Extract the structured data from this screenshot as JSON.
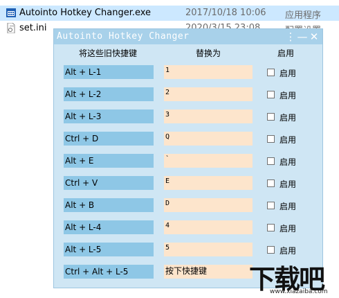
{
  "explorer": {
    "files": [
      {
        "name": "Autointo Hotkey Changer.exe",
        "date": "2017/10/18 10:06",
        "type": "应用程序",
        "icon": "exe-icon"
      },
      {
        "name": "set.ini",
        "date": "2020/3/15 23:08",
        "type": "配置设置",
        "icon": "ini-file-icon"
      }
    ]
  },
  "window": {
    "title": "Autointo Hotkey Changer",
    "menu_glyph": "⋮",
    "min_glyph": "—",
    "close_glyph": "✕"
  },
  "headers": {
    "old_hotkey": "将这些旧快捷键",
    "replace_with": "替换为",
    "enable": "启用"
  },
  "rows": [
    {
      "hotkey": "Alt + L-1",
      "replace": "1",
      "enable_label": "启用"
    },
    {
      "hotkey": "Alt + L-2",
      "replace": "2",
      "enable_label": "启用"
    },
    {
      "hotkey": "Alt + L-3",
      "replace": "3",
      "enable_label": "启用"
    },
    {
      "hotkey": "Ctrl + D",
      "replace": "Q",
      "enable_label": "启用"
    },
    {
      "hotkey": "Alt + E",
      "replace": "`",
      "enable_label": "启用"
    },
    {
      "hotkey": "Ctrl + V",
      "replace": "E",
      "enable_label": "启用"
    },
    {
      "hotkey": "Alt + B",
      "replace": "D",
      "enable_label": "启用"
    },
    {
      "hotkey": "Alt + L-4",
      "replace": "4",
      "enable_label": "启用"
    },
    {
      "hotkey": "Alt + L-5",
      "replace": "5",
      "enable_label": "启用"
    }
  ],
  "last_row": {
    "hotkey": "Ctrl + Alt + L-5",
    "replace": "按下快捷键"
  },
  "watermark": {
    "big": "下载吧",
    "small": "www.xiazaiba.com"
  },
  "colors": {
    "titlebar": "#a8d1ea",
    "window_bg": "#cfe6f4",
    "hotkey_bg": "#8ec7e6",
    "replace_bg": "#fde5cc",
    "selected_row": "#cce8ff"
  }
}
